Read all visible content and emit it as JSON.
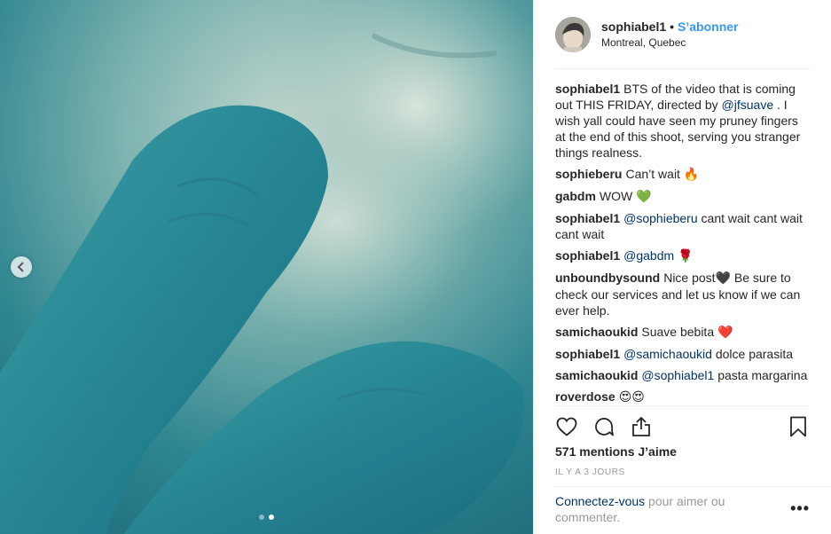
{
  "post": {
    "username": "sophiabel1",
    "separator": "•",
    "follow_label": "S’abonner",
    "location": "Montreal, Quebec"
  },
  "caption": {
    "user": "sophiabel1",
    "text_before": "BTS of the video that is coming out THIS FRIDAY, directed by",
    "mention": "@jfsuave",
    "text_after": ". I wish yall could have seen my pruney fingers at the end of this shoot, serving you stranger things realness."
  },
  "comments": [
    {
      "user": "sophieberu",
      "text": "Can’t wait",
      "emoji": "🔥"
    },
    {
      "user": "gabdm",
      "text": "WOW",
      "emoji": "💚"
    },
    {
      "user": "sophiabel1",
      "mention": "@sophieberu",
      "text": "cant wait cant wait cant wait"
    },
    {
      "user": "sophiabel1",
      "mention": "@gabdm",
      "emoji": "🌹"
    },
    {
      "user": "unboundbysound",
      "text": "Nice post",
      "emoji": "🖤",
      "text2": "Be sure to check our services and let us know if we can ever help."
    },
    {
      "user": "samichaoukid",
      "text": "Suave bebita",
      "emoji": "❤️"
    },
    {
      "user": "sophiabel1",
      "mention": "@samichaoukid",
      "text": "dolce parasita"
    },
    {
      "user": "samichaoukid",
      "mention": "@sophiabel1",
      "text": "pasta margarina"
    },
    {
      "user": "roverdose",
      "emoji": "😍😍"
    }
  ],
  "actions": {
    "like_icon": "heart-icon",
    "comment_icon": "comment-icon",
    "share_icon": "share-icon",
    "save_icon": "bookmark-icon"
  },
  "likes_label": "571 mentions J’aime",
  "timestamp": "IL Y A 3 JOURS",
  "footer": {
    "login_link": "Connectez-vous",
    "login_text": " pour aimer ou commenter.",
    "more_label": "•••"
  },
  "carousel": {
    "slide_count": 2,
    "active_slide": 2
  },
  "colors": {
    "accent": "#3897f0",
    "mention": "#003569",
    "muted": "#999999"
  }
}
